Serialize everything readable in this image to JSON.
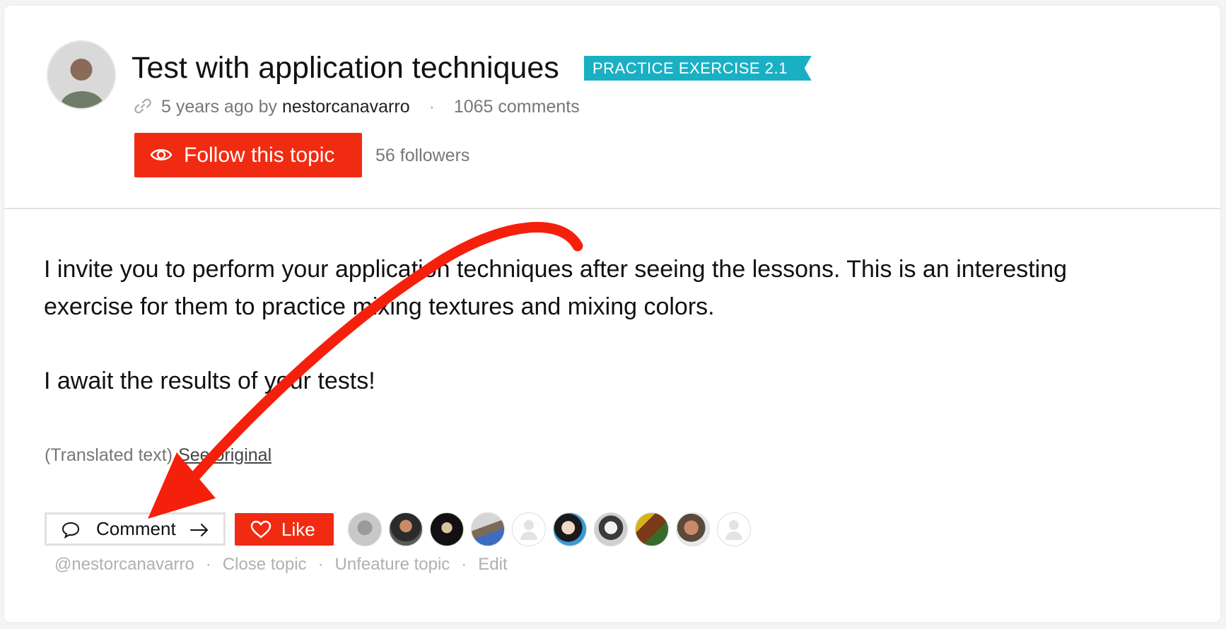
{
  "topic": {
    "title": "Test with application techniques",
    "tag": "PRACTICE EXERCISE 2.1",
    "age": "5 years ago by",
    "author": "nestorcanavarro",
    "comments": "1065 comments",
    "follow_label": "Follow this topic",
    "followers": "56 followers"
  },
  "body": {
    "paragraph_1": "I invite you to perform your application techniques after seeing the lessons. This is an interesting exercise for them to practice mixing textures and mixing colors.",
    "paragraph_2": "I await the results of your tests!",
    "translated": "(Translated text)",
    "see_original": "See original"
  },
  "actions": {
    "comment_label": "Comment",
    "like_label": "Like",
    "mention": "@nestorcanavarro",
    "close": "Close topic",
    "unfeature": "Unfeature topic",
    "edit": "Edit"
  },
  "colors": {
    "accent_red": "#f12b12",
    "tag_teal": "#1ab0c4",
    "annotation_arrow": "#f5200b"
  },
  "likers": [
    "avatar",
    "avatar",
    "avatar",
    "avatar",
    "placeholder",
    "avatar",
    "avatar",
    "avatar",
    "avatar",
    "placeholder"
  ]
}
